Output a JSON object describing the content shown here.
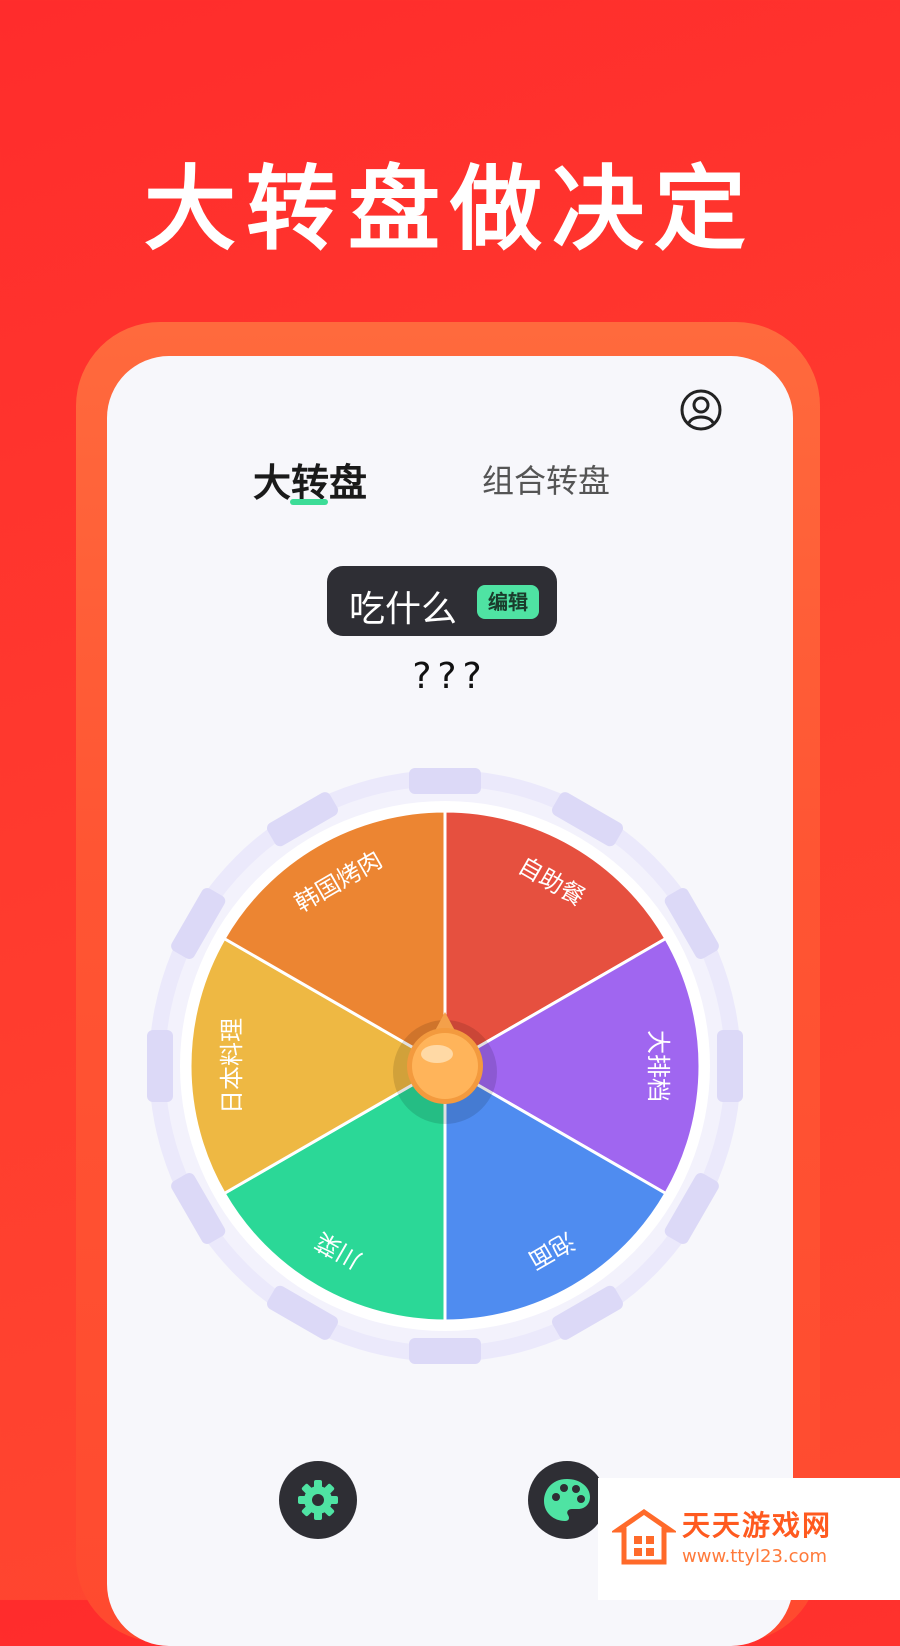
{
  "headline": "大转盘做决定",
  "tabs": [
    {
      "label": "大转盘",
      "active": true
    },
    {
      "label": "组合转盘",
      "active": false
    }
  ],
  "topic": {
    "title": "吃什么",
    "edit_label": "编辑"
  },
  "result": "???",
  "wheel": {
    "segments": [
      {
        "label": "自助餐",
        "color": "#e6503f"
      },
      {
        "label": "大排档",
        "color": "#a066f0"
      },
      {
        "label": "泡面",
        "color": "#4f8cf0"
      },
      {
        "label": "川菜",
        "color": "#2bd897"
      },
      {
        "label": "日本料理",
        "color": "#eeb843"
      },
      {
        "label": "韩国烤肉",
        "color": "#ec8532"
      }
    ]
  },
  "icons": {
    "profile": "user-circle-icon",
    "settings": "gear-icon",
    "theme": "palette-icon",
    "pointer": "spin-pointer-icon"
  },
  "watermark": {
    "brand": "天天游戏网",
    "url": "www.ttyl23.com"
  },
  "colors": {
    "background": "#ff2c2c",
    "accent": "#3ddc97",
    "dark": "#2e2e34"
  }
}
